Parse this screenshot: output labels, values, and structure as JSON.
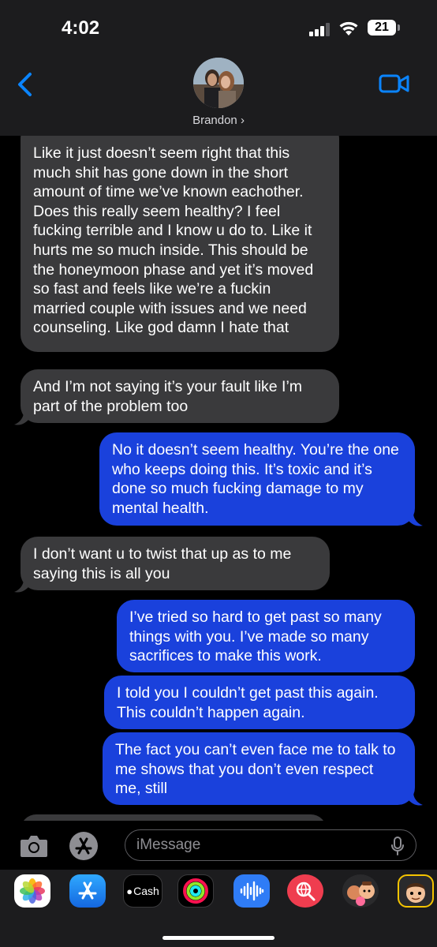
{
  "status_bar": {
    "time": "4:02",
    "battery": "21"
  },
  "header": {
    "contact_name": "Brandon ›"
  },
  "messages": [
    {
      "direction": "in",
      "text": "Like it just doesn’t seem right that this much shit has gone down in the short amount of time we’ve known eachother. Does this really seem healthy? I feel fucking terrible and I know u do to. Like it hurts me so much inside. This should be the honeymoon phase and yet it’s moved so fast and feels like we’re a fuckin married couple with issues and we need counseling. Like god damn I hate that"
    },
    {
      "direction": "in",
      "text": "And I’m not saying it’s your fault like I’m part of the problem too"
    },
    {
      "direction": "out",
      "text": "No it doesn’t seem healthy. You’re the one who keeps doing this. It’s toxic and it’s done so much fucking damage to my mental health."
    },
    {
      "direction": "in",
      "text": "I don’t want u to twist that up as to me saying this is all you"
    },
    {
      "direction": "out",
      "text": "I’ve tried so hard to get past so many things with you. I’ve made so many sacrifices to make this work."
    },
    {
      "direction": "out",
      "text": "I told you I couldn’t get past this again. This couldn’t happen again."
    },
    {
      "direction": "out",
      "text": "The fact you can’t even face me to talk to me shows that you don’t even respect me, still"
    }
  ],
  "input": {
    "placeholder": "iMessage"
  },
  "app_drawer": {
    "cash_label": "Cash",
    "apps": [
      "photos-app",
      "app-store-app",
      "apple-cash-app",
      "fitness-app",
      "audio-message-app",
      "image-search-app",
      "memoji-app",
      "memoji-app-2"
    ]
  },
  "colors": {
    "outgoing_bubble": "#1a41dc",
    "incoming_bubble": "#3a3a3c",
    "header_bg": "#1c1c1e",
    "accent": "#0a84ff"
  }
}
